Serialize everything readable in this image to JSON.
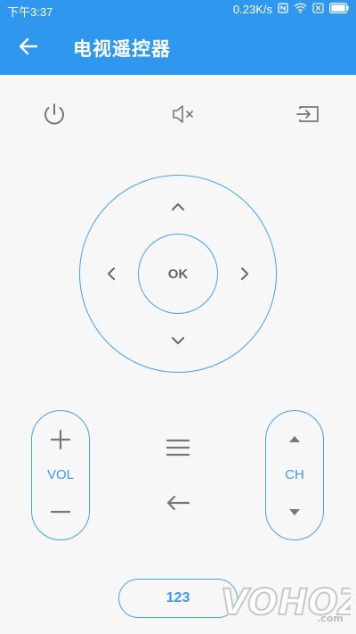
{
  "status_bar": {
    "time": "下午3:37",
    "speed": "0.23K/s"
  },
  "header": {
    "title": "电视遥控器"
  },
  "top_buttons": {
    "power_icon": "power-icon",
    "mute_icon": "mute-icon",
    "input_icon": "input-source-icon"
  },
  "dpad": {
    "ok_label": "OK"
  },
  "volume": {
    "label": "VOL"
  },
  "channel": {
    "label": "CH"
  },
  "number_pad": {
    "label": "123"
  },
  "watermark": {
    "text": "VOHOZ.com"
  },
  "colors": {
    "primary": "#2f98ee",
    "accent_stroke": "#45a3ee",
    "icon_gray": "#777777",
    "background": "#f7f7f7"
  }
}
